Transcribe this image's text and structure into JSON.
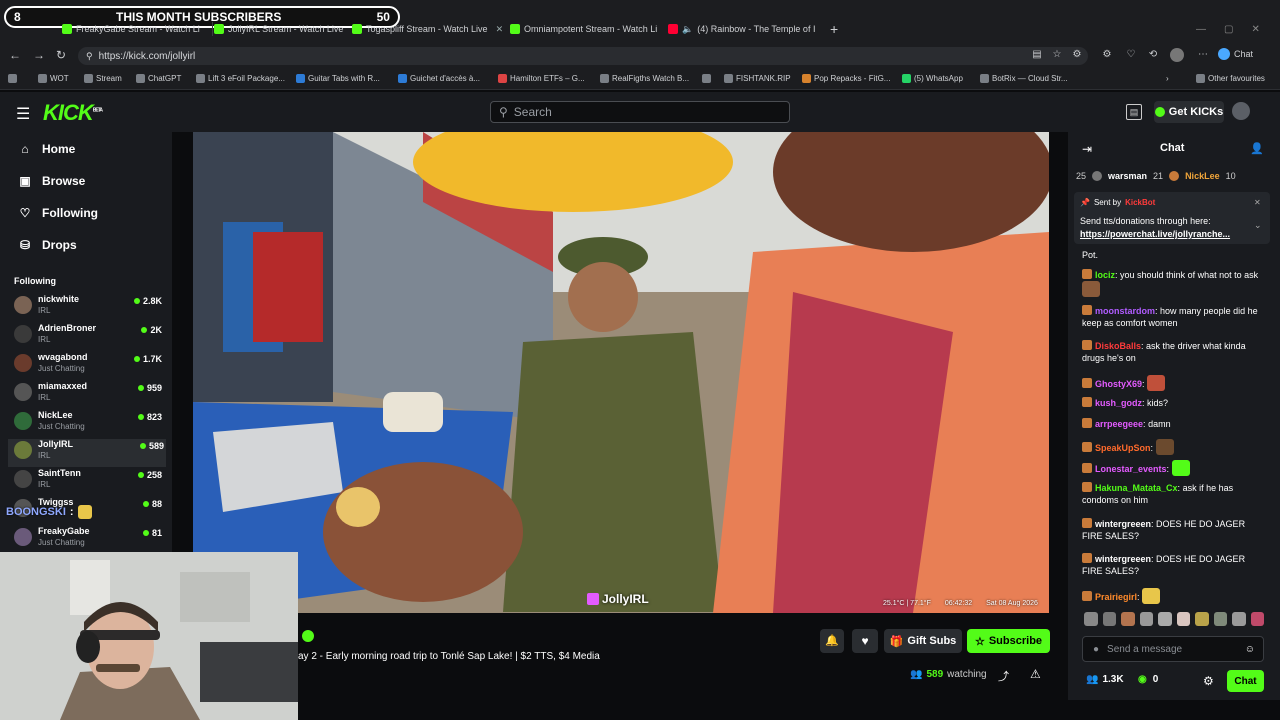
{
  "browser": {
    "tabs": [
      {
        "label": "FreakyGabe Stream - Watch Li"
      },
      {
        "label": "JollyIRL Stream - Watch Live"
      },
      {
        "label": "Togaspliff Stream - Watch Live"
      },
      {
        "label": "Omniampotent Stream - Watch Li"
      },
      {
        "label": "(4) Rainbow - The Temple of I"
      }
    ],
    "url": "https://kick.com/jollyirl",
    "copilot_label": "Chat",
    "bookmarks": [
      "WOT",
      "Stream",
      "ChatGPT",
      "Lift 3 eFoil Package...",
      "Guitar Tabs with R...",
      "Guichet d'accès à...",
      "Hamilton ETFs – G...",
      "RealFigths Watch B...",
      "FISHTANK.RIP",
      "Pop Repacks - FitG...",
      "(5) WhatsApp",
      "BotRix — Cloud Str..."
    ],
    "other_favourites": "Other favourites"
  },
  "overlay": {
    "subs_left": "8",
    "subs_title": "THIS MONTH SUBSCRIBERS",
    "subs_right": "50"
  },
  "header": {
    "logo": "KICK",
    "logo_badge": "BETA",
    "search_placeholder": "Search",
    "get_kicks": "Get KICKs"
  },
  "sidebar": {
    "nav": [
      "Home",
      "Browse",
      "Following",
      "Drops"
    ],
    "following_title": "Following",
    "following": [
      {
        "name": "nickwhite",
        "category": "IRL",
        "viewers": "2.8K"
      },
      {
        "name": "AdrienBroner",
        "category": "IRL",
        "viewers": "2K"
      },
      {
        "name": "wvagabond",
        "category": "Just Chatting",
        "viewers": "1.7K"
      },
      {
        "name": "miamaxxed",
        "category": "IRL",
        "viewers": "959"
      },
      {
        "name": "NickLee",
        "category": "Just Chatting",
        "viewers": "823"
      },
      {
        "name": "JollyIRL",
        "category": "IRL",
        "viewers": "589"
      },
      {
        "name": "SaintTenn",
        "category": "IRL",
        "viewers": "258"
      },
      {
        "name": "Twiggss",
        "category": "",
        "viewers": "88"
      },
      {
        "name": "FreakyGabe",
        "category": "Just Chatting",
        "viewers": "81"
      }
    ],
    "overlay_name": "BOONGSKI"
  },
  "video": {
    "watermark": "JollyIRL",
    "hud_temp": "25.1°C | 77.1°F",
    "hud_time": "06:42:32",
    "hud_date": "Sat 08 Aug 2026"
  },
  "stream": {
    "title": "ay 2 - Early morning road trip to Tonlé Sap Lake! | $2 TTS, $4 Media",
    "watching_count": "589",
    "watching_label": "watching",
    "gift_subs": "Gift Subs",
    "subscribe": "Subscribe"
  },
  "chat": {
    "title": "Chat",
    "leaderboard": [
      {
        "name": "",
        "value": "25"
      },
      {
        "name": "warsman",
        "value": "21"
      },
      {
        "name": "NickLee",
        "value": "10"
      }
    ],
    "pinned": {
      "sent_by": "Sent by",
      "sender": "KickBot",
      "text": "Send tts/donations through here:",
      "link": "https://powerchat.live/jollyranche..."
    },
    "messages": [
      {
        "user": "",
        "text": "Pot.",
        "color": "#ffffff"
      },
      {
        "user": "lociz",
        "text": "you should think of what not to ask",
        "color": "#53fc18"
      },
      {
        "user": "moonstardom",
        "text": "how many people did he keep as comfort women",
        "color": "#b05cff"
      },
      {
        "user": "DiskoBalls",
        "text": "ask the driver what kinda drugs he's on",
        "color": "#ff3b3b"
      },
      {
        "user": "GhostyX69",
        "text": "",
        "color": "#e35bff"
      },
      {
        "user": "kush_godz",
        "text": "kids?",
        "color": "#e35bff"
      },
      {
        "user": "arrpeegeee",
        "text": "damn",
        "color": "#e35bff"
      },
      {
        "user": "SpeakUpSon",
        "text": "",
        "color": "#ff6a2b"
      },
      {
        "user": "Lonestar_events",
        "text": "",
        "color": "#e35bff"
      },
      {
        "user": "Hakuna_Matata_Cx",
        "text": "ask if he has condoms on him",
        "color": "#53fc18"
      },
      {
        "user": "wintergreeen",
        "text": "DOES HE DO JAGER FIRE SALES?",
        "color": "#ffffff"
      },
      {
        "user": "wintergreeen",
        "text": "DOES HE DO JAGER FIRE SALES?",
        "color": "#ffffff"
      },
      {
        "user": "Prairiegirl",
        "text": "",
        "color": "#ff8a2b"
      }
    ],
    "input_placeholder": "Send a message",
    "followers": "1.3K",
    "kicks": "0",
    "chat_button": "Chat"
  },
  "colors": {
    "accent": "#53fc18",
    "bg": "#0b0c0e",
    "panel": "#191b1f"
  }
}
